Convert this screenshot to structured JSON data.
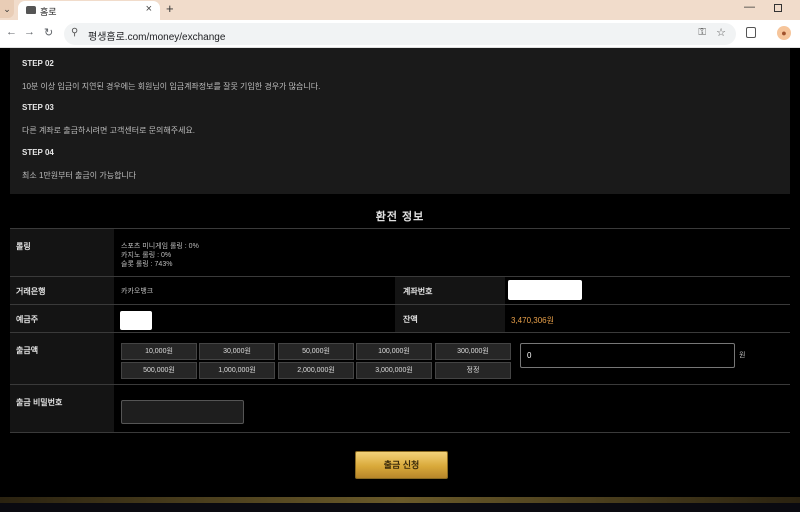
{
  "browser": {
    "tab_title": "홈로",
    "url": "평생홈로.com/money/exchange",
    "new_tab": "+",
    "close_tab": "×",
    "minimize": "—"
  },
  "steps": [
    {
      "title": "STEP 02",
      "text": "10분 이상 입금이 지연된 경우에는 회원님이 입금계좌정보를 잘못 기입한 경우가 많습니다."
    },
    {
      "title": "STEP 03",
      "text": "다른 계좌로 출금하시려면 고객센터로 문의해주세요."
    },
    {
      "title": "STEP 04",
      "text": "최소 1만원부터 출금이 가능합니다"
    }
  ],
  "section_title": "환전 정보",
  "rolling": {
    "label": "롤링",
    "lines": [
      "스포츠 미니게임 롤링 : 0%",
      "카지노 롤링 : 0%",
      "슬롯 롤링 : 743%"
    ]
  },
  "bank": {
    "label": "거래은행",
    "value": "카카오뱅크"
  },
  "account": {
    "label": "계좌번호"
  },
  "holder": {
    "label": "예금주"
  },
  "balance": {
    "label": "잔액",
    "value": "3,470,306원"
  },
  "amount": {
    "label": "출금액",
    "buttons": [
      "10,000원",
      "30,000원",
      "50,000원",
      "100,000원",
      "300,000원",
      "500,000원",
      "1,000,000원",
      "2,000,000원",
      "3,000,000원",
      "정정"
    ],
    "input_value": "0",
    "unit": "원"
  },
  "password": {
    "label": "출금 비밀번호"
  },
  "submit_label": "출금 신청",
  "colors": {
    "accent_gold": "#d9a93a",
    "balance_orange": "#e8a04a"
  }
}
